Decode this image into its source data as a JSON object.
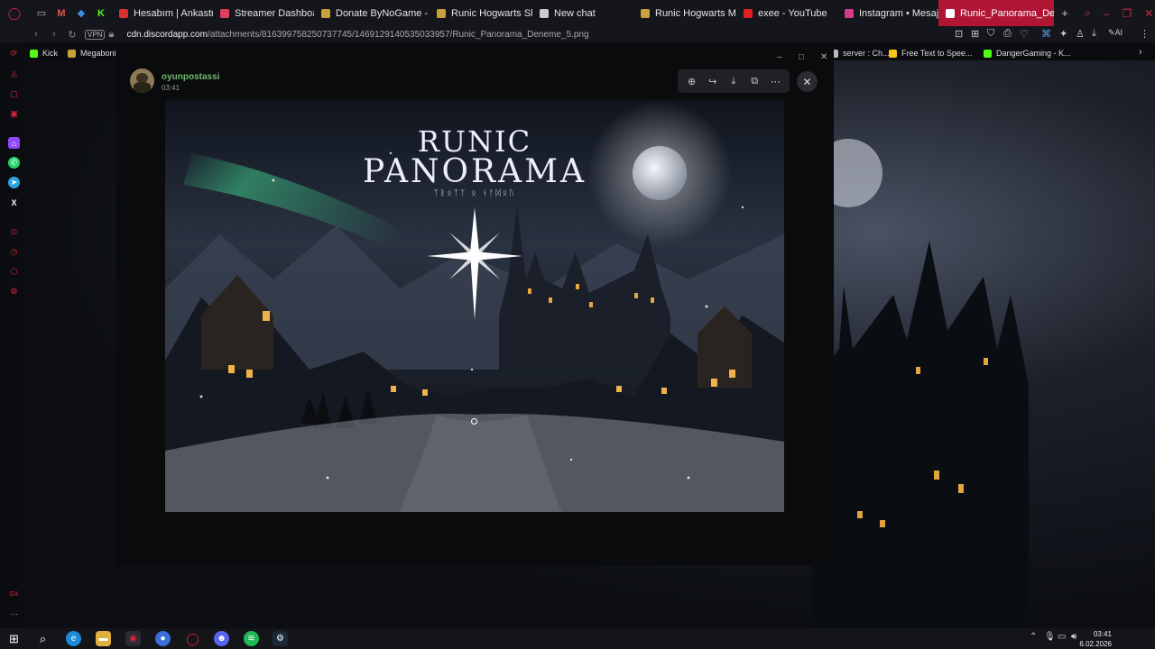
{
  "tabs": [
    {
      "label": "Hesabım | Ankastre Se",
      "color": "#d93030",
      "active": false
    },
    {
      "label": "Streamer Dashboard",
      "color": "#e0405a",
      "active": false
    },
    {
      "label": "Donate ByNoGame - d",
      "color": "#c9a13a",
      "active": false
    },
    {
      "label": "Runic Hogwarts Shop",
      "color": "#c9a13a",
      "active": false
    },
    {
      "label": "New chat",
      "color": "#cccccc",
      "active": false
    },
    {
      "label": "Runic Hogwarts Mağa",
      "color": "#c9a13a",
      "active": false
    },
    {
      "label": "exee - YouTube",
      "color": "#e02020",
      "active": false
    },
    {
      "label": "Instagram • Mesajlar",
      "color": "#d63a8a",
      "active": false
    },
    {
      "label": "Runic_Panorama_Deneme",
      "color": "#ffffff",
      "active": true
    }
  ],
  "address": {
    "vpn_label": "VPN",
    "url_domain": "cdn.discordapp.com",
    "url_path": "/attachments/816399758250737745/1469129140535033957/Runic_Panorama_Deneme_5.png"
  },
  "bookmarks": [
    {
      "label": "Kick",
      "color": "#53fc18"
    },
    {
      "label": "Megaboni",
      "color": "#c9a13a"
    },
    {
      "label": "server : Ch...",
      "color": "#bbbbbb"
    },
    {
      "label": "Free Text to Spee...",
      "color": "#f5c518"
    },
    {
      "label": "DangerGaming - K...",
      "color": "#53fc18"
    }
  ],
  "viewer": {
    "username": "oyunpostassi",
    "time": "03:41",
    "image_title_line1": "RUNIC",
    "image_title_line2": "PANORAMA",
    "image_subtitle": "ᛉᚱᛟᛉᛉ ᛟ ᚾᚨᛞᛟᚢ"
  },
  "taskbar": {
    "time": "03:41",
    "date": "6.02.2026"
  },
  "colors": {
    "accent": "#b01634",
    "username": "#6fb96a"
  }
}
